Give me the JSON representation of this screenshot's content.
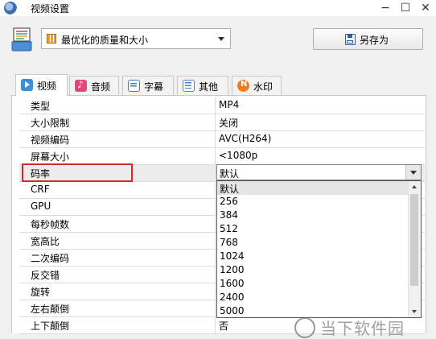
{
  "window": {
    "title": "视频设置"
  },
  "preset": {
    "selected": "最优化的质量和大小"
  },
  "save_as": {
    "label": "另存为"
  },
  "tabs": [
    {
      "label": "视频",
      "icon": "video-icon",
      "active": true
    },
    {
      "label": "音频",
      "icon": "music-icon",
      "active": false
    },
    {
      "label": "字幕",
      "icon": "subtitle-icon",
      "active": false
    },
    {
      "label": "其他",
      "icon": "settings-list-icon",
      "active": false
    },
    {
      "label": "水印",
      "icon": "new-badge-icon",
      "active": false
    }
  ],
  "properties": [
    {
      "name": "类型",
      "value": "MP4"
    },
    {
      "name": "大小限制",
      "value": "关闭"
    },
    {
      "name": "视频编码",
      "value": "AVC(H264)"
    },
    {
      "name": "屏幕大小",
      "value": "<1080p"
    },
    {
      "name": "码率",
      "value": "默认"
    },
    {
      "name": "CRF",
      "value": ""
    },
    {
      "name": "GPU",
      "value": ""
    },
    {
      "name": "每秒帧数",
      "value": ""
    },
    {
      "name": "宽高比",
      "value": ""
    },
    {
      "name": "二次编码",
      "value": ""
    },
    {
      "name": "反交错",
      "value": ""
    },
    {
      "name": "旋转",
      "value": ""
    },
    {
      "name": "左右颠倒",
      "value": ""
    },
    {
      "name": "上下颠倒",
      "value": "否"
    }
  ],
  "bitrate_dropdown": {
    "selected": "默认",
    "options": [
      "默认",
      "256",
      "384",
      "512",
      "768",
      "1024",
      "1200",
      "1600",
      "2400",
      "5000"
    ]
  },
  "watermark": {
    "text": "当下软件园"
  },
  "colors": {
    "highlight_border": "#d42a2a",
    "accent": "#2c5fa3"
  }
}
